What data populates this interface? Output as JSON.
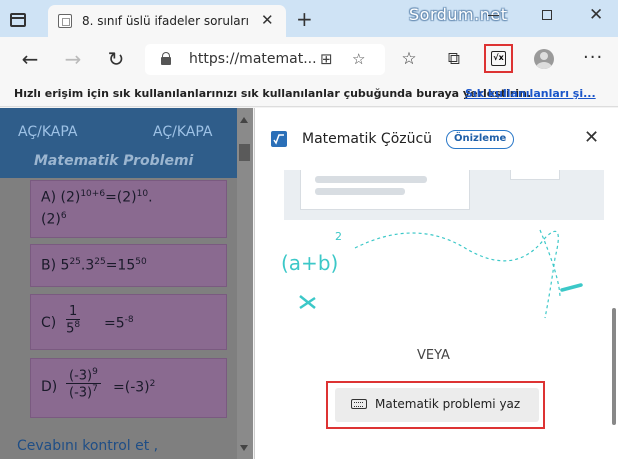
{
  "browser": {
    "tab_title": "8. sınıf üslü ifadeler soruları",
    "watermark": "Sordum.net",
    "url": "https://matemat..."
  },
  "favorites_bar": {
    "prompt": "Hızlı erişim için sık kullanılanlarınızı sık kullanılanlar çubuğunda buraya yerleştirin.",
    "link": "Sık kullanılanları şi..."
  },
  "page": {
    "toggle_left": "AÇ/KAPA",
    "toggle_right": "AÇ/KAPA",
    "heading": "Matematik Problemi",
    "options": [
      {
        "letter": "A)",
        "text": "(2)10+6=(2)10. (2)6"
      },
      {
        "letter": "B)",
        "text": "525.325=1550"
      },
      {
        "letter": "C)",
        "text": "1 / 58 =5-8"
      },
      {
        "letter": "D)",
        "text": "(-3)9 / (-3)7 =(-3)2"
      }
    ],
    "a_line1_pre": "A) (2)",
    "a_sup1": "10+6",
    "a_mid": "=(2)",
    "a_sup2": "10",
    "a_tail": ".",
    "a_line2_pre": "(2)",
    "a_sup3": "6",
    "b_pre": "B) 5",
    "b_sup1": "25",
    "b_mid1": ".3",
    "b_sup2": "25",
    "b_mid2": "=15",
    "b_sup3": "50",
    "c_label": "C)",
    "c_num": "1",
    "c_den_base": "5",
    "c_den_sup": "8",
    "c_rhs": "=5",
    "c_rhs_sup": "-8",
    "d_label": "D)",
    "d_num_base": "(-3)",
    "d_num_sup": "9",
    "d_den_base": "(-3)",
    "d_den_sup": "7",
    "d_rhs": "=(-3)",
    "d_rhs_sup": "2",
    "check_answer": "Cevabını kontrol et ,"
  },
  "panel": {
    "title": "Matematik Çözücü",
    "badge": "Önizleme",
    "illustration_text": "(a+b)",
    "illustration_sup": "2",
    "or_text": "VEYA",
    "write_button": "Matematik problemi yaz"
  },
  "colors": {
    "accent_red": "#dd3333",
    "teal": "#3cc8c8",
    "link_blue": "#1a55c9"
  }
}
